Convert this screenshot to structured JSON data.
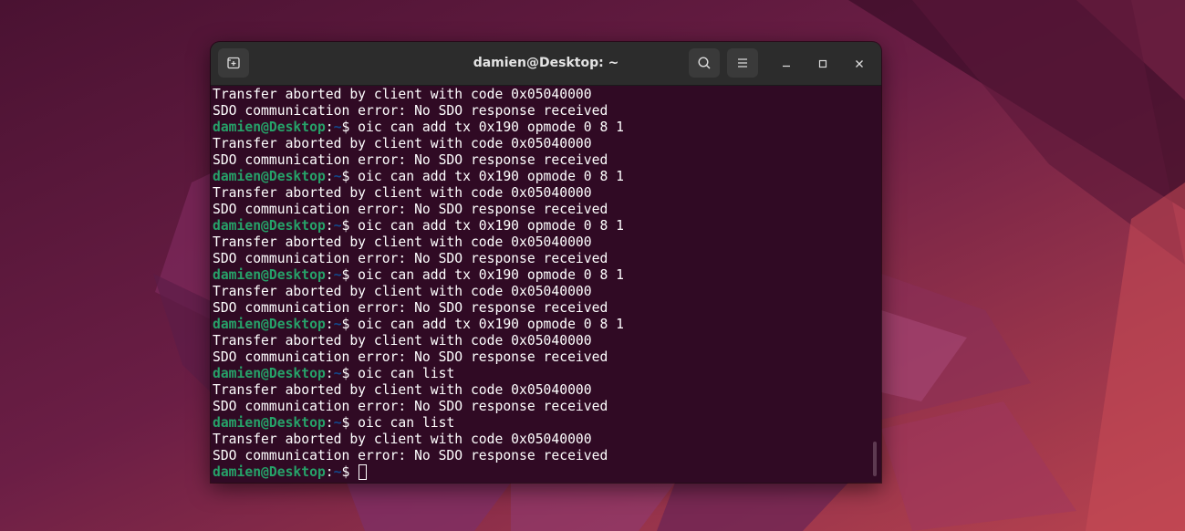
{
  "window": {
    "title": "damien@Desktop: ~",
    "new_tab_icon": "new-tab-icon",
    "search_icon": "search-icon",
    "menu_icon": "hamburger-menu-icon",
    "minimize_icon": "minimize-icon",
    "maximize_icon": "maximize-icon",
    "close_icon": "close-icon"
  },
  "colors": {
    "terminal_bg": "#300a24",
    "prompt_user": "#26a269",
    "prompt_path": "#12488b",
    "text": "#ffffff"
  },
  "terminal": {
    "lines": [
      {
        "type": "output",
        "text": "Transfer aborted by client with code 0x05040000"
      },
      {
        "type": "output",
        "text": "SDO communication error: No SDO response received"
      },
      {
        "type": "prompt",
        "user": "damien@Desktop",
        "sep": ":",
        "path": "~",
        "sym": "$ ",
        "cmd": "oic can add tx 0x190 opmode 0 8 1"
      },
      {
        "type": "output",
        "text": "Transfer aborted by client with code 0x05040000"
      },
      {
        "type": "output",
        "text": "SDO communication error: No SDO response received"
      },
      {
        "type": "prompt",
        "user": "damien@Desktop",
        "sep": ":",
        "path": "~",
        "sym": "$ ",
        "cmd": "oic can add tx 0x190 opmode 0 8 1"
      },
      {
        "type": "output",
        "text": "Transfer aborted by client with code 0x05040000"
      },
      {
        "type": "output",
        "text": "SDO communication error: No SDO response received"
      },
      {
        "type": "prompt",
        "user": "damien@Desktop",
        "sep": ":",
        "path": "~",
        "sym": "$ ",
        "cmd": "oic can add tx 0x190 opmode 0 8 1"
      },
      {
        "type": "output",
        "text": "Transfer aborted by client with code 0x05040000"
      },
      {
        "type": "output",
        "text": "SDO communication error: No SDO response received"
      },
      {
        "type": "prompt",
        "user": "damien@Desktop",
        "sep": ":",
        "path": "~",
        "sym": "$ ",
        "cmd": "oic can add tx 0x190 opmode 0 8 1"
      },
      {
        "type": "output",
        "text": "Transfer aborted by client with code 0x05040000"
      },
      {
        "type": "output",
        "text": "SDO communication error: No SDO response received"
      },
      {
        "type": "prompt",
        "user": "damien@Desktop",
        "sep": ":",
        "path": "~",
        "sym": "$ ",
        "cmd": "oic can add tx 0x190 opmode 0 8 1"
      },
      {
        "type": "output",
        "text": "Transfer aborted by client with code 0x05040000"
      },
      {
        "type": "output",
        "text": "SDO communication error: No SDO response received"
      },
      {
        "type": "prompt",
        "user": "damien@Desktop",
        "sep": ":",
        "path": "~",
        "sym": "$ ",
        "cmd": "oic can list"
      },
      {
        "type": "output",
        "text": "Transfer aborted by client with code 0x05040000"
      },
      {
        "type": "output",
        "text": "SDO communication error: No SDO response received"
      },
      {
        "type": "prompt",
        "user": "damien@Desktop",
        "sep": ":",
        "path": "~",
        "sym": "$ ",
        "cmd": "oic can list"
      },
      {
        "type": "output",
        "text": "Transfer aborted by client with code 0x05040000"
      },
      {
        "type": "output",
        "text": "SDO communication error: No SDO response received"
      },
      {
        "type": "prompt",
        "user": "damien@Desktop",
        "sep": ":",
        "path": "~",
        "sym": "$ ",
        "cmd": "",
        "cursor": true
      }
    ]
  }
}
